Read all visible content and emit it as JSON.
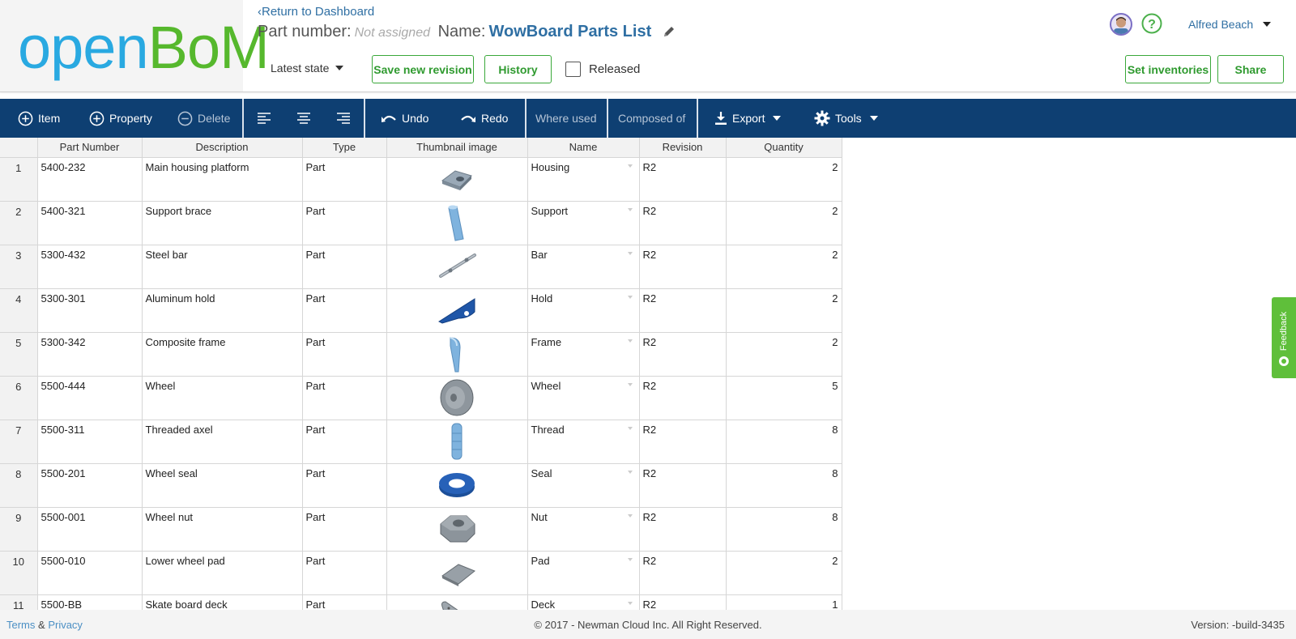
{
  "header": {
    "logo_open": "open",
    "logo_bom": "BoM",
    "back_link": "Return to Dashboard",
    "part_number_label": "Part number:",
    "part_number_value": "Not assigned",
    "name_label": "Name:",
    "bom_name": "WowBoard Parts List",
    "state": "Latest state",
    "save_revision": "Save new revision",
    "history": "History",
    "released": "Released",
    "set_inventories": "Set inventories",
    "share": "Share",
    "user_name": "Alfred Beach"
  },
  "toolbar": {
    "item": "Item",
    "property": "Property",
    "delete": "Delete",
    "undo": "Undo",
    "redo": "Redo",
    "where_used": "Where used",
    "composed_of": "Composed of",
    "export": "Export",
    "tools": "Tools"
  },
  "table": {
    "columns": [
      "",
      "Part Number",
      "Description",
      "Type",
      "Thumbnail image",
      "Name",
      "Revision",
      "Quantity"
    ],
    "rows": [
      {
        "n": "1",
        "part": "5400-232",
        "desc": "Main housing platform",
        "type": "Part",
        "thumb": "housing",
        "name": "Housing",
        "rev": "R2",
        "qty": "2"
      },
      {
        "n": "2",
        "part": "5400-321",
        "desc": "Support brace",
        "type": "Part",
        "thumb": "support",
        "name": "Support",
        "rev": "R2",
        "qty": "2"
      },
      {
        "n": "3",
        "part": "5300-432",
        "desc": "Steel bar",
        "type": "Part",
        "thumb": "bar",
        "name": "Bar",
        "rev": "R2",
        "qty": "2"
      },
      {
        "n": "4",
        "part": "5300-301",
        "desc": "Aluminum hold",
        "type": "Part",
        "thumb": "hold",
        "name": "Hold",
        "rev": "R2",
        "qty": "2"
      },
      {
        "n": "5",
        "part": "5300-342",
        "desc": "Composite frame",
        "type": "Part",
        "thumb": "frame",
        "name": "Frame",
        "rev": "R2",
        "qty": "2"
      },
      {
        "n": "6",
        "part": "5500-444",
        "desc": "Wheel",
        "type": "Part",
        "thumb": "wheel",
        "name": "Wheel",
        "rev": "R2",
        "qty": "5"
      },
      {
        "n": "7",
        "part": "5500-311",
        "desc": "Threaded axel",
        "type": "Part",
        "thumb": "thread",
        "name": "Thread",
        "rev": "R2",
        "qty": "8"
      },
      {
        "n": "8",
        "part": "5500-201",
        "desc": "Wheel seal",
        "type": "Part",
        "thumb": "seal",
        "name": "Seal",
        "rev": "R2",
        "qty": "8"
      },
      {
        "n": "9",
        "part": "5500-001",
        "desc": "Wheel nut",
        "type": "Part",
        "thumb": "nut",
        "name": "Nut",
        "rev": "R2",
        "qty": "8"
      },
      {
        "n": "10",
        "part": "5500-010",
        "desc": "Lower wheel pad",
        "type": "Part",
        "thumb": "pad",
        "name": "Pad",
        "rev": "R2",
        "qty": "2"
      },
      {
        "n": "11",
        "part": "5500-BB",
        "desc": "Skate board deck",
        "type": "Part",
        "thumb": "deck",
        "name": "Deck",
        "rev": "R2",
        "qty": "1"
      }
    ]
  },
  "footer": {
    "terms": "Terms",
    "amp": "&",
    "privacy": "Privacy",
    "copyright": "© 2017 - Newman Cloud Inc. All Right Reserved.",
    "version": "Version: -build-3435"
  },
  "feedback": "Feedback",
  "colors": {
    "toolbar": "#0e3f72",
    "accent_green": "#3aa83a",
    "link_blue": "#2f6fa3",
    "logo_blue": "#29a9e1",
    "logo_green": "#56b82d"
  }
}
